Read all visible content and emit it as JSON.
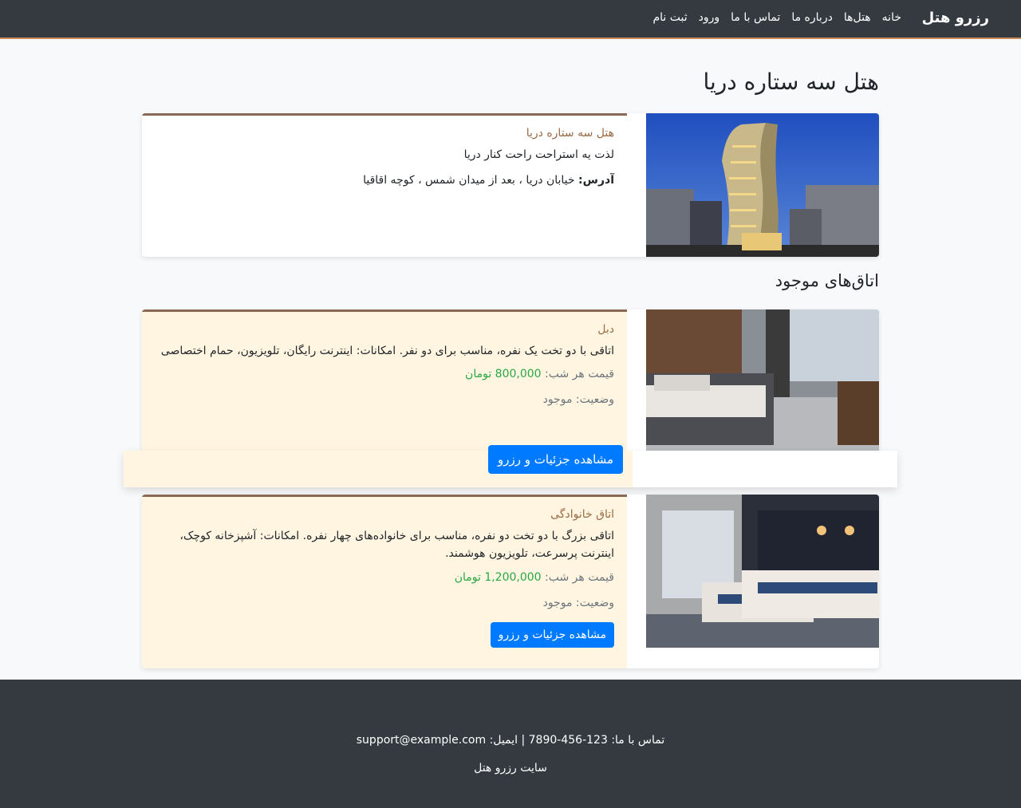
{
  "nav": {
    "brand": "رزرو هتل",
    "links": [
      "خانه",
      "هتل‌ها",
      "درباره ما",
      "تماس با ما",
      "ورود",
      "ثبت نام"
    ]
  },
  "page_title": "هتل سه ستاره دریا",
  "hotel": {
    "name": "هتل سه ستاره دریا",
    "tagline": "لذت یه استراحت راحت کنار دریا",
    "address_label": "آدرس:",
    "address": "خیابان دریا ، بعد از میدان شمس ، کوچه اقاقیا"
  },
  "rooms_title": "اتاق‌های موجود",
  "rooms": [
    {
      "name": "دبل",
      "description": "اتاقی با دو تخت یک نفره، مناسب برای دو نفر. امکانات: اینترنت رایگان، تلویزیون، حمام اختصاصی",
      "price_label": "قیمت هر شب:",
      "price": "800,000 تومان",
      "status": "وضعیت: موجود",
      "button": "مشاهده جزئیات و رزرو"
    },
    {
      "name": "اتاق خانوادگی",
      "description": "اتاقی بزرگ با دو تخت دو نفره، مناسب برای خانواده‌های چهار نفره. امکانات: آشپزخانه کوچک، اینترنت پرسرعت، تلویزیون هوشمند.",
      "price_label": "قیمت هر شب:",
      "price": "1,200,000 تومان",
      "status": "وضعیت: موجود",
      "button": "مشاهده جزئیات و رزرو"
    }
  ],
  "footer": {
    "contact": "تماس با ما: 123-456-7890 | ایمیل: support@example.com",
    "copyright": "سایت رزرو هتل"
  }
}
